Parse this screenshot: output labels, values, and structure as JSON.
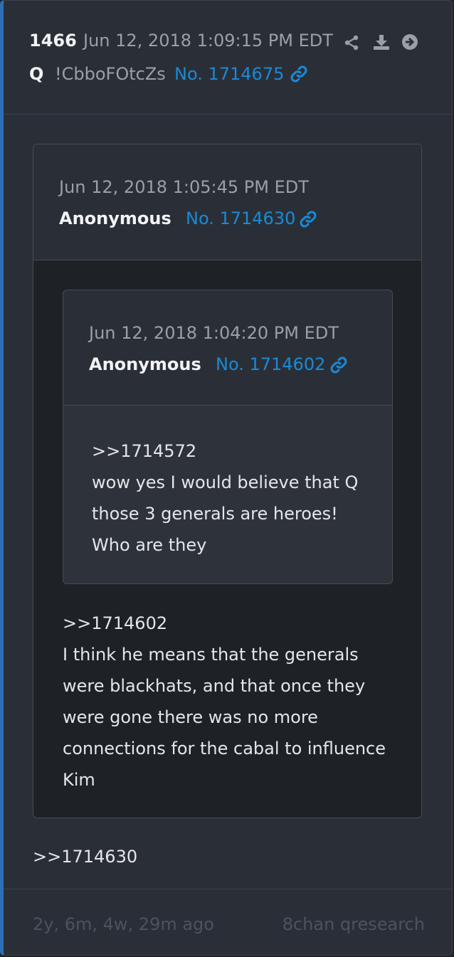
{
  "post": {
    "count": "1466",
    "datetime": "Jun 12, 2018 1:09:15 PM EDT",
    "author": "Q",
    "tripcode": "!CbboFOtcZs",
    "post_no": "No. 1714675",
    "body": ">>1714630",
    "actions": [
      "share-icon",
      "download-icon",
      "arrow-right-circle-icon"
    ]
  },
  "quote1": {
    "datetime": "Jun 12, 2018 1:05:45 PM EDT",
    "author": "Anonymous",
    "post_no": "No. 1714630",
    "lines": [
      ">>1714602",
      "I think he means that the generals",
      "were blackhats, and that once they",
      "were gone there was no more",
      "connections for the cabal to influence",
      "Kim"
    ]
  },
  "quote2": {
    "datetime": "Jun 12, 2018 1:04:20 PM EDT",
    "author": "Anonymous",
    "post_no": "No. 1714602",
    "lines": [
      ">>1714572",
      "wow yes I would believe that Q",
      "those 3 generals are heroes!",
      "Who are they"
    ]
  },
  "footer": {
    "age": "2y, 6m, 4w, 29m ago",
    "source": "8chan qresearch"
  },
  "colors": {
    "accent": "#2d6fb7",
    "link": "#1a8ad6"
  }
}
